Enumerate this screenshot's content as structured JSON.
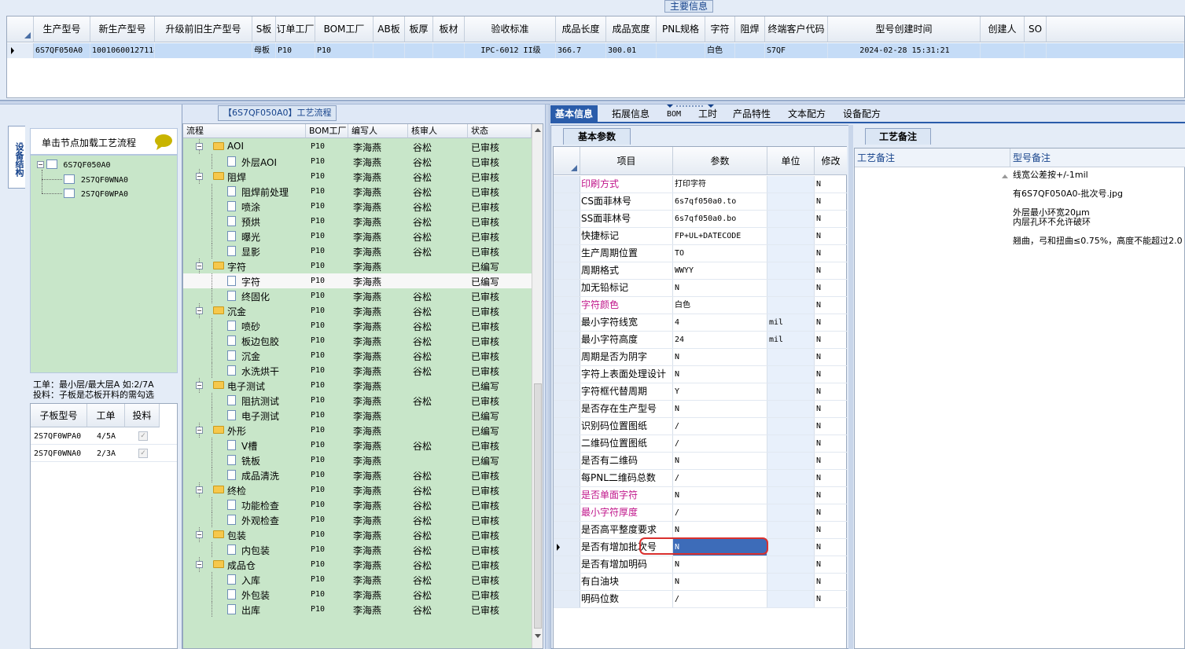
{
  "top": {
    "title": "主要信息",
    "columns": [
      "生产型号",
      "新生产型号",
      "升级前旧生产型号",
      "S板",
      "订单工厂",
      "BOM工厂",
      "AB板",
      "板厚",
      "板材",
      "验收标准",
      "成品长度",
      "成品宽度",
      "PNL规格",
      "字符",
      "阻焊",
      "终端客户代码",
      "型号创建时间",
      "创建人",
      "SO"
    ],
    "row": [
      "6S7QF050A0",
      "10010600127114",
      "",
      "母板",
      "P10",
      "P10",
      "",
      "",
      "",
      "IPC-6012 II级",
      "366.7",
      "300.01",
      "",
      "白色",
      "",
      "S7QF",
      "2024-02-28 15:31:21",
      "",
      ""
    ]
  },
  "left": {
    "vertical_tab": "设备结构",
    "load_label": "单击节点加载工艺流程",
    "tree": [
      "6S7QF050A0",
      "2S7QF0WNA0",
      "2S7QF0WPA0"
    ],
    "info_line1": "工单：最小层/最大层A 如:2/7A",
    "info_line2": "投料：子板是芯板开料的需勾选",
    "sub_headers": [
      "子板型号",
      "工单",
      "投料"
    ],
    "sub_rows": [
      {
        "model": "2S7QF0WPA0",
        "order": "4/5A"
      },
      {
        "model": "2S7QF0WNA0",
        "order": "2/3A"
      }
    ]
  },
  "flow": {
    "title": "【6S7QF050A0】工艺流程",
    "headers": [
      "流程",
      "BOM工厂",
      "编写人",
      "核审人",
      "状态"
    ],
    "rows": [
      {
        "name": "AOI",
        "level": 0,
        "bom": "P10",
        "writer": "李海燕",
        "reviewer": "谷松",
        "status": "已审核"
      },
      {
        "name": "外层AOI",
        "level": 1,
        "bom": "P10",
        "writer": "李海燕",
        "reviewer": "谷松",
        "status": "已审核"
      },
      {
        "name": "阻焊",
        "level": 0,
        "bom": "P10",
        "writer": "李海燕",
        "reviewer": "谷松",
        "status": "已审核"
      },
      {
        "name": "阻焊前处理",
        "level": 1,
        "bom": "P10",
        "writer": "李海燕",
        "reviewer": "谷松",
        "status": "已审核"
      },
      {
        "name": "喷涂",
        "level": 1,
        "bom": "P10",
        "writer": "李海燕",
        "reviewer": "谷松",
        "status": "已审核"
      },
      {
        "name": "预烘",
        "level": 1,
        "bom": "P10",
        "writer": "李海燕",
        "reviewer": "谷松",
        "status": "已审核"
      },
      {
        "name": "曝光",
        "level": 1,
        "bom": "P10",
        "writer": "李海燕",
        "reviewer": "谷松",
        "status": "已审核"
      },
      {
        "name": "显影",
        "level": 1,
        "bom": "P10",
        "writer": "李海燕",
        "reviewer": "谷松",
        "status": "已审核"
      },
      {
        "name": "字符",
        "level": 0,
        "bom": "P10",
        "writer": "李海燕",
        "reviewer": "",
        "status": "已编写"
      },
      {
        "name": "字符",
        "level": 1,
        "bom": "P10",
        "writer": "李海燕",
        "reviewer": "",
        "status": "已编写"
      },
      {
        "name": "终固化",
        "level": 1,
        "bom": "P10",
        "writer": "李海燕",
        "reviewer": "谷松",
        "status": "已审核"
      },
      {
        "name": "沉金",
        "level": 0,
        "bom": "P10",
        "writer": "李海燕",
        "reviewer": "谷松",
        "status": "已审核"
      },
      {
        "name": "喷砂",
        "level": 1,
        "bom": "P10",
        "writer": "李海燕",
        "reviewer": "谷松",
        "status": "已审核"
      },
      {
        "name": "板边包胶",
        "level": 1,
        "bom": "P10",
        "writer": "李海燕",
        "reviewer": "谷松",
        "status": "已审核"
      },
      {
        "name": "沉金",
        "level": 1,
        "bom": "P10",
        "writer": "李海燕",
        "reviewer": "谷松",
        "status": "已审核"
      },
      {
        "name": "水洗烘干",
        "level": 1,
        "bom": "P10",
        "writer": "李海燕",
        "reviewer": "谷松",
        "status": "已审核"
      },
      {
        "name": "电子测试",
        "level": 0,
        "bom": "P10",
        "writer": "李海燕",
        "reviewer": "",
        "status": "已编写"
      },
      {
        "name": "阻抗测试",
        "level": 1,
        "bom": "P10",
        "writer": "李海燕",
        "reviewer": "谷松",
        "status": "已审核"
      },
      {
        "name": "电子测试",
        "level": 1,
        "bom": "P10",
        "writer": "李海燕",
        "reviewer": "",
        "status": "已编写"
      },
      {
        "name": "外形",
        "level": 0,
        "bom": "P10",
        "writer": "李海燕",
        "reviewer": "",
        "status": "已编写"
      },
      {
        "name": "V槽",
        "level": 1,
        "bom": "P10",
        "writer": "李海燕",
        "reviewer": "谷松",
        "status": "已审核"
      },
      {
        "name": "铣板",
        "level": 1,
        "bom": "P10",
        "writer": "李海燕",
        "reviewer": "",
        "status": "已编写"
      },
      {
        "name": "成品清洗",
        "level": 1,
        "bom": "P10",
        "writer": "李海燕",
        "reviewer": "谷松",
        "status": "已审核"
      },
      {
        "name": "终检",
        "level": 0,
        "bom": "P10",
        "writer": "李海燕",
        "reviewer": "谷松",
        "status": "已审核"
      },
      {
        "name": "功能检查",
        "level": 1,
        "bom": "P10",
        "writer": "李海燕",
        "reviewer": "谷松",
        "status": "已审核"
      },
      {
        "name": "外观检查",
        "level": 1,
        "bom": "P10",
        "writer": "李海燕",
        "reviewer": "谷松",
        "status": "已审核"
      },
      {
        "name": "包装",
        "level": 0,
        "bom": "P10",
        "writer": "李海燕",
        "reviewer": "谷松",
        "status": "已审核"
      },
      {
        "name": "内包装",
        "level": 1,
        "bom": "P10",
        "writer": "李海燕",
        "reviewer": "谷松",
        "status": "已审核"
      },
      {
        "name": "成品仓",
        "level": 0,
        "bom": "P10",
        "writer": "李海燕",
        "reviewer": "谷松",
        "status": "已审核"
      },
      {
        "name": "入库",
        "level": 1,
        "bom": "P10",
        "writer": "李海燕",
        "reviewer": "谷松",
        "status": "已审核"
      },
      {
        "name": "外包装",
        "level": 1,
        "bom": "P10",
        "writer": "李海燕",
        "reviewer": "谷松",
        "status": "已审核"
      },
      {
        "name": "出库",
        "level": 1,
        "bom": "P10",
        "writer": "李海燕",
        "reviewer": "谷松",
        "status": "已审核"
      }
    ]
  },
  "right": {
    "tabs": [
      "基本信息",
      "拓展信息",
      "BOM",
      "工时",
      "产品特性",
      "文本配方",
      "设备配方"
    ],
    "param_tab": "基本参数",
    "param_headers": [
      "项目",
      "参数",
      "单位",
      "修改"
    ],
    "params": [
      {
        "item": "印刷方式",
        "value": "打印字符",
        "unit": "",
        "mod": "N",
        "magenta": true
      },
      {
        "item": "CS面菲林号",
        "value": "6s7qf050a0.to",
        "unit": "",
        "mod": "N",
        "magenta": false
      },
      {
        "item": "SS面菲林号",
        "value": "6s7qf050a0.bo",
        "unit": "",
        "mod": "N",
        "magenta": false
      },
      {
        "item": "快捷标记",
        "value": "FP+UL+DATECODE",
        "unit": "",
        "mod": "N",
        "magenta": false
      },
      {
        "item": "生产周期位置",
        "value": "TO",
        "unit": "",
        "mod": "N",
        "magenta": false
      },
      {
        "item": "周期格式",
        "value": "WWYY",
        "unit": "",
        "mod": "N",
        "magenta": false
      },
      {
        "item": "加无铅标记",
        "value": "N",
        "unit": "",
        "mod": "N",
        "magenta": false
      },
      {
        "item": "字符颜色",
        "value": "白色",
        "unit": "",
        "mod": "N",
        "magenta": true
      },
      {
        "item": "最小字符线宽",
        "value": "4",
        "unit": "mil",
        "mod": "N",
        "magenta": false
      },
      {
        "item": "最小字符高度",
        "value": "24",
        "unit": "mil",
        "mod": "N",
        "magenta": false
      },
      {
        "item": "周期是否为阴字",
        "value": "N",
        "unit": "",
        "mod": "N",
        "magenta": false
      },
      {
        "item": "字符上表面处理设计",
        "value": "N",
        "unit": "",
        "mod": "N",
        "magenta": false
      },
      {
        "item": "字符框代替周期",
        "value": "Y",
        "unit": "",
        "mod": "N",
        "magenta": false
      },
      {
        "item": "是否存在生产型号",
        "value": "N",
        "unit": "",
        "mod": "N",
        "magenta": false
      },
      {
        "item": "识别码位置图纸",
        "value": "/",
        "unit": "",
        "mod": "N",
        "magenta": false
      },
      {
        "item": "二维码位置图纸",
        "value": "/",
        "unit": "",
        "mod": "N",
        "magenta": false
      },
      {
        "item": "是否有二维码",
        "value": "N",
        "unit": "",
        "mod": "N",
        "magenta": false
      },
      {
        "item": "每PNL二维码总数",
        "value": "/",
        "unit": "",
        "mod": "N",
        "magenta": false
      },
      {
        "item": "是否单面字符",
        "value": "N",
        "unit": "",
        "mod": "N",
        "magenta": true
      },
      {
        "item": "最小字符厚度",
        "value": "/",
        "unit": "",
        "mod": "N",
        "magenta": true
      },
      {
        "item": "是否高平整度要求",
        "value": "N",
        "unit": "",
        "mod": "N",
        "magenta": false
      },
      {
        "item": "是否有增加批次号",
        "value": "N",
        "unit": "",
        "mod": "N",
        "magenta": false
      },
      {
        "item": "是否有增加明码",
        "value": "N",
        "unit": "",
        "mod": "N",
        "magenta": false
      },
      {
        "item": "有白油块",
        "value": "N",
        "unit": "",
        "mod": "N",
        "magenta": false
      },
      {
        "item": "明码位数",
        "value": "/",
        "unit": "",
        "mod": "N",
        "magenta": false
      }
    ],
    "remark_tab": "工艺备注",
    "remark_header_left": "工艺备注",
    "remark_header_right": "型号备注",
    "remarks": [
      "线宽公差按+/-1mil",
      "有6S7QF050A0-批次号.jpg",
      "外层最小环宽20μm",
      "内层孔环不允许破环",
      "翘曲，弓和扭曲≤0.75%，高度不能超过2.0"
    ]
  },
  "colors": {
    "selection": "#c5dcf7",
    "tree_bg": "#c8e6c9",
    "tab_active": "#2a5caa",
    "highlight_ring": "#d9302e",
    "magenta": "#c0168b"
  }
}
